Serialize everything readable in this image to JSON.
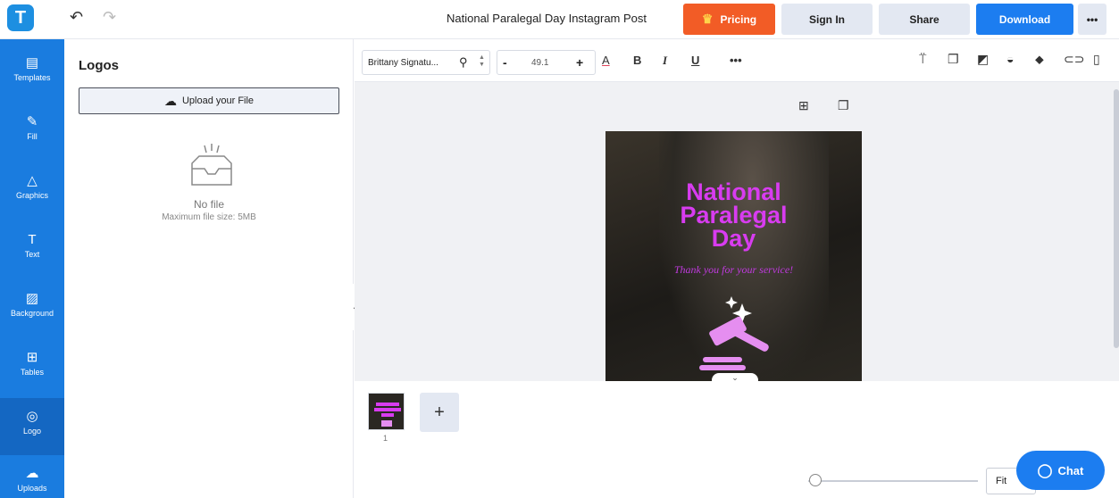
{
  "app": {
    "logo_letter": "T",
    "undo_icon": "↶",
    "redo_icon": "↷",
    "document_title": "National Paralegal Day Instagram Post",
    "accent_color": "#1c7df0"
  },
  "header": {
    "pricing": "Pricing",
    "sign_in": "Sign In",
    "share": "Share",
    "download": "Download",
    "more": "•••"
  },
  "sidebar": {
    "items": [
      {
        "label": "Templates",
        "icon": "▤"
      },
      {
        "label": "Fill",
        "icon": "✎"
      },
      {
        "label": "Graphics",
        "icon": "△"
      },
      {
        "label": "Text",
        "icon": "T"
      },
      {
        "label": "Background",
        "icon": "▨"
      },
      {
        "label": "Tables",
        "icon": "⊞"
      },
      {
        "label": "Logo",
        "icon": "◎"
      },
      {
        "label": "Uploads",
        "icon": "☁"
      }
    ]
  },
  "panel": {
    "title": "Logos",
    "upload_label": "Upload your File",
    "empty_text": "No file",
    "max_size_text": "Maximum file size: 5MB"
  },
  "toolbar": {
    "font_name": "Brittany Signatu...",
    "font_size": "49.1",
    "minus": "-",
    "plus": "+",
    "color_label": "A",
    "bold_label": "B",
    "italic_label": "I",
    "underline_label": "U",
    "more_label": "•••"
  },
  "artboard": {
    "title_lines": [
      "National",
      "Paralegal",
      "Day"
    ],
    "subtitle": "Thank you for your service!",
    "title_color": "#d83cf0"
  },
  "pages": {
    "current_page": "1",
    "add_label": "+"
  },
  "zoom": {
    "fit_label": "Fit",
    "level": 0.04
  },
  "chat": {
    "label": "Chat"
  }
}
